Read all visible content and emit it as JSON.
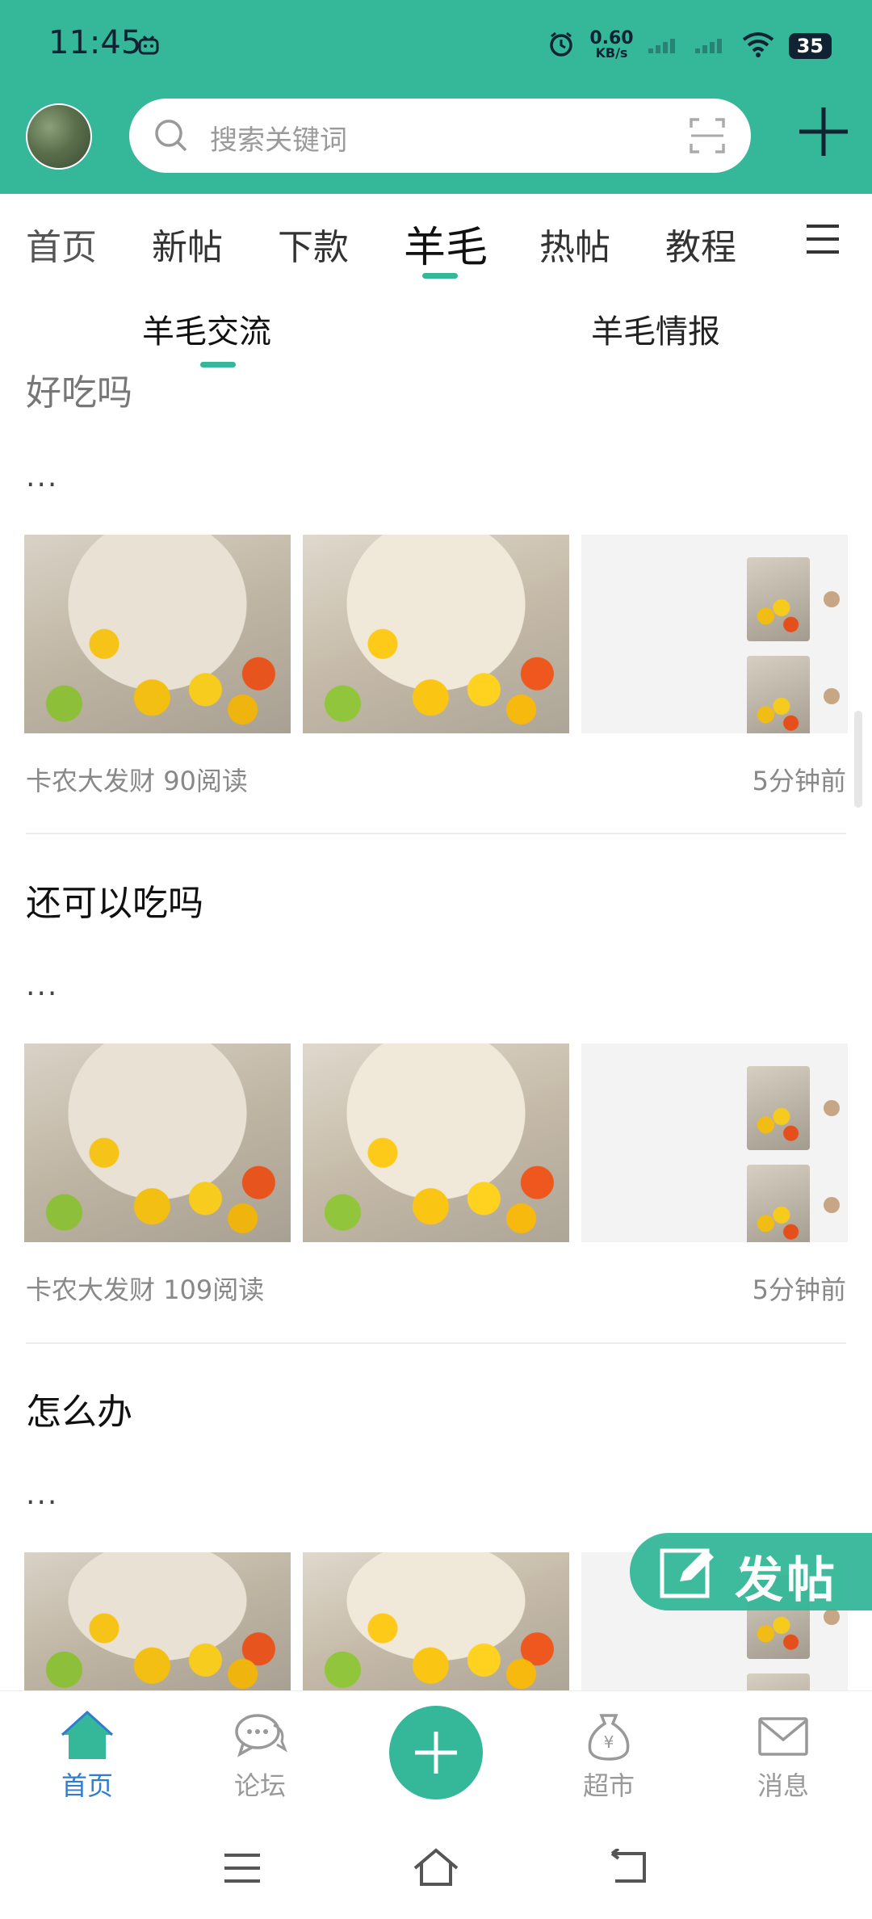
{
  "status": {
    "time": "11:45",
    "net_speed_value": "0.60",
    "net_speed_unit": "KB/s",
    "battery": "35"
  },
  "header": {
    "search_placeholder": "搜索关键词"
  },
  "tabs": [
    {
      "label": "首页"
    },
    {
      "label": "新帖"
    },
    {
      "label": "下款"
    },
    {
      "label": "羊毛"
    },
    {
      "label": "热帖"
    },
    {
      "label": "教程"
    }
  ],
  "subtabs": [
    {
      "label": "羊毛交流"
    },
    {
      "label": "羊毛情报"
    }
  ],
  "posts": [
    {
      "title": "好吃吗",
      "excerpt": "...",
      "author": "卡农大发财",
      "reads": "90阅读",
      "time": "5分钟前"
    },
    {
      "title": "还可以吃吗",
      "excerpt": "...",
      "author": "卡农大发财",
      "reads": "109阅读",
      "time": "5分钟前"
    },
    {
      "title": "怎么办",
      "excerpt": "..."
    }
  ],
  "fab": {
    "label": "发帖"
  },
  "bottom_nav": [
    {
      "label": "首页",
      "icon": "home-icon"
    },
    {
      "label": "论坛",
      "icon": "chat-bubbles-icon"
    },
    {
      "label": "",
      "icon": "plus-icon"
    },
    {
      "label": "超市",
      "icon": "money-bag-icon"
    },
    {
      "label": "消息",
      "icon": "mail-icon"
    }
  ],
  "colors": {
    "accent": "#35b799",
    "active_nav": "#2f7dd1"
  }
}
